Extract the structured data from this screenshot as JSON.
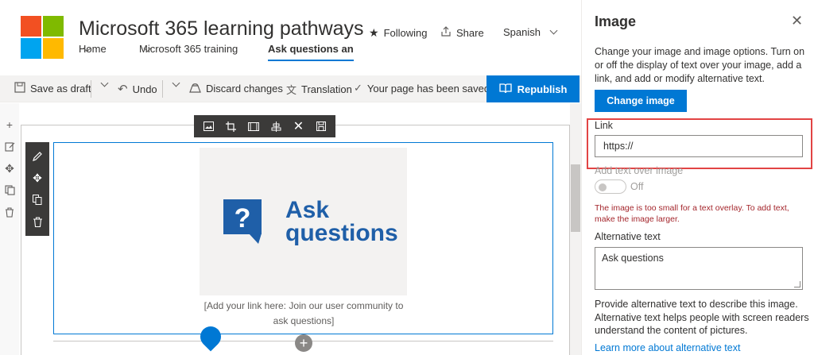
{
  "header": {
    "site_title": "Microsoft 365 learning pathways",
    "nav": [
      {
        "label": "Home"
      },
      {
        "label": "Microsoft 365 training"
      },
      {
        "label": "Ask questions and g"
      }
    ],
    "following_label": "Following",
    "share_label": "Share",
    "language_label": "Spanish"
  },
  "command_bar": {
    "save_draft_label": "Save as draft",
    "undo_label": "Undo",
    "discard_label": "Discard changes",
    "translation_label": "Translation",
    "status_text": "Your page has been saved",
    "republish_label": "Republish"
  },
  "canvas": {
    "image_text_line1": "Ask",
    "image_text_line2": "questions",
    "caption": "[Add your link here: Join our user community to ask questions]",
    "brand_color": "#1f5fa8"
  },
  "panel": {
    "title": "Image",
    "description": "Change your image and image options. Turn on or off the display of text over your image, add a link, and add or modify alternative text.",
    "change_image_label": "Change image",
    "link_label": "Link",
    "link_value": "https://",
    "overlay_label": "Add text over image",
    "overlay_state": "Off",
    "warning": "The image is too small for a text overlay. To add text, make the image larger.",
    "alt_label": "Alternative text",
    "alt_value": "Ask questions",
    "help_text": "Provide alternative text to describe this image. Alternative text helps people with screen readers understand the content of pictures.",
    "learn_more": "Learn more about alternative text"
  },
  "colors": {
    "accent": "#0078d4",
    "warning": "#a4262c",
    "highlight": "#e24444"
  }
}
